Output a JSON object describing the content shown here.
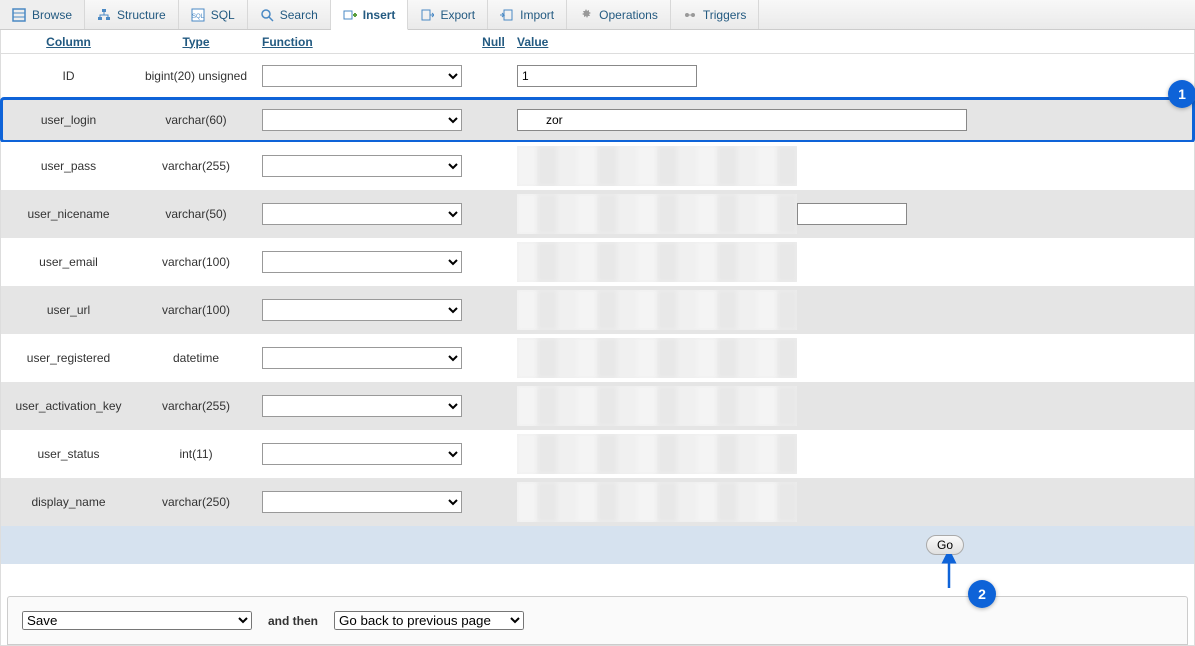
{
  "tabs": [
    {
      "label": "Browse",
      "icon": "browse-icon"
    },
    {
      "label": "Structure",
      "icon": "structure-icon"
    },
    {
      "label": "SQL",
      "icon": "sql-icon"
    },
    {
      "label": "Search",
      "icon": "search-icon"
    },
    {
      "label": "Insert",
      "icon": "insert-icon"
    },
    {
      "label": "Export",
      "icon": "export-icon"
    },
    {
      "label": "Import",
      "icon": "import-icon"
    },
    {
      "label": "Operations",
      "icon": "operations-icon"
    },
    {
      "label": "Triggers",
      "icon": "triggers-icon"
    }
  ],
  "active_tab_index": 4,
  "headers": {
    "column": "Column",
    "type": "Type",
    "function": "Function",
    "null": "Null",
    "value": "Value"
  },
  "rows": [
    {
      "column": "ID",
      "type": "bigint(20) unsigned",
      "value": "1",
      "blur": false,
      "width": "first"
    },
    {
      "column": "user_login",
      "type": "varchar(60)",
      "value": "zor",
      "blur": false,
      "width": "full",
      "highlight": true
    },
    {
      "column": "user_pass",
      "type": "varchar(255)",
      "value": "",
      "blur": true
    },
    {
      "column": "user_nicename",
      "type": "varchar(50)",
      "value": "",
      "blur": true,
      "show_tail_input": true,
      "tail_width": "mid"
    },
    {
      "column": "user_email",
      "type": "varchar(100)",
      "value": "",
      "blur": true
    },
    {
      "column": "user_url",
      "type": "varchar(100)",
      "value": "",
      "blur": true
    },
    {
      "column": "user_registered",
      "type": "datetime",
      "value": "",
      "blur": true
    },
    {
      "column": "user_activation_key",
      "type": "varchar(255)",
      "value": "",
      "blur": true
    },
    {
      "column": "user_status",
      "type": "int(11)",
      "value": "",
      "blur": true
    },
    {
      "column": "display_name",
      "type": "varchar(250)",
      "value": "",
      "blur": true
    }
  ],
  "go_label": "Go",
  "footer": {
    "save_options": [
      "Save"
    ],
    "save_selected": "Save",
    "and_then": "and then",
    "then_options": [
      "Go back to previous page"
    ],
    "then_selected": "Go back to previous page"
  },
  "markers": {
    "row_user_login": "1",
    "go_button": "2"
  }
}
